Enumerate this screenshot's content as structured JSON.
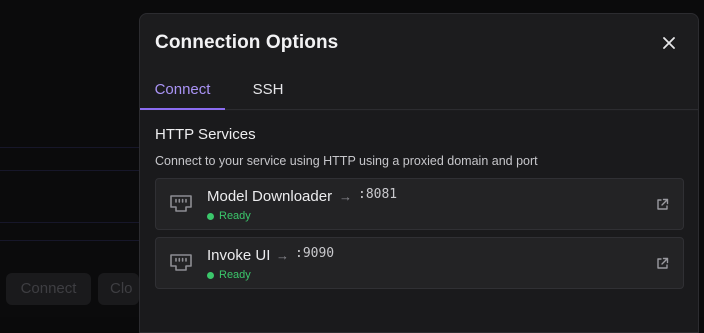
{
  "background": {
    "buttons": [
      "Connect",
      "Clo"
    ]
  },
  "modal": {
    "title": "Connection Options",
    "tabs": [
      {
        "label": "Connect",
        "active": true
      },
      {
        "label": "SSH",
        "active": false
      }
    ],
    "section": {
      "title": "HTTP Services",
      "description": "Connect to your service using HTTP using a proxied domain and port"
    },
    "services": [
      {
        "name": "Model Downloader",
        "arrow": "→",
        "port": ":8081",
        "status": "Ready"
      },
      {
        "name": "Invoke UI",
        "arrow": "→",
        "port": ":9090",
        "status": "Ready"
      }
    ]
  },
  "colors": {
    "accent": "#8b6cf0",
    "status_ready": "#3bc76b",
    "modal_bg": "#1c1c1e"
  },
  "icons": {
    "service": "ethernet-port-icon",
    "external": "external-link-icon",
    "close": "close-icon"
  }
}
